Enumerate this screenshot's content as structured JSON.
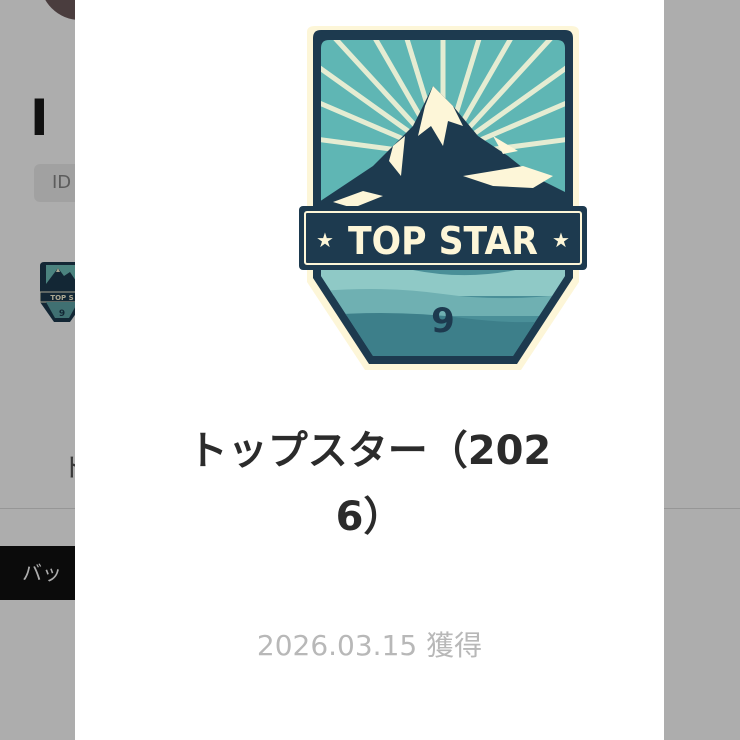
{
  "background": {
    "title_fragment": "I",
    "id_label": "ID",
    "thumb_text": "TOP S",
    "thumb_number": "9",
    "caption_fragment": "ト",
    "button_fragment": "バッ"
  },
  "modal": {
    "badge": {
      "icon": "mountain-badge-icon",
      "banner_text": "TOP STAR",
      "number": "9",
      "colors": {
        "navy": "#1d3a4f",
        "sky": "#5fb6b4",
        "cream": "#fdf6d8",
        "lake": "#3d7f8a"
      }
    },
    "title": "トップスター（2026）",
    "date_text": "2026.03.15 獲得"
  }
}
